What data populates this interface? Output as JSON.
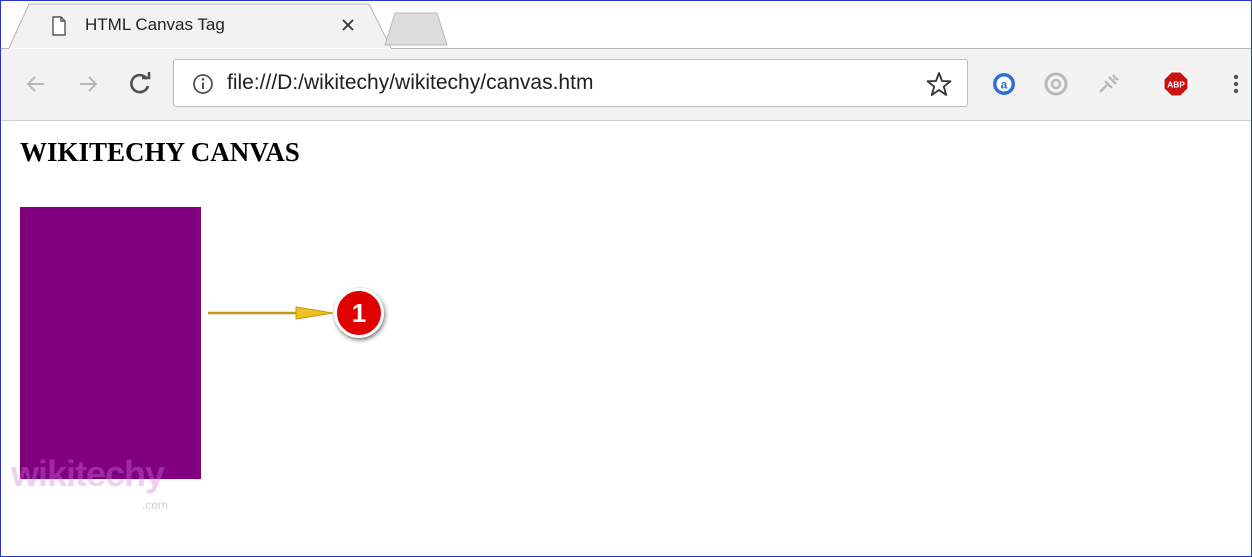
{
  "tab": {
    "title": "HTML Canvas Tag",
    "close_glyph": "✕",
    "icon": "page-icon"
  },
  "toolbar": {
    "back_glyph": "←",
    "forward_glyph": "→",
    "reload_glyph": "C",
    "url": "file:///D:/wikitechy/wikitechy/canvas.htm",
    "star_glyph": "☆",
    "menu_glyph": "⋮",
    "extensions": [
      {
        "name": "a-extension",
        "glyph": "a"
      },
      {
        "name": "ring-extension",
        "glyph": ""
      },
      {
        "name": "puzzle-extension",
        "glyph": ""
      },
      {
        "name": "adblock-extension",
        "glyph": "ABP"
      }
    ]
  },
  "page": {
    "heading": "WIKITECHY CANVAS",
    "canvas_fill": "#800080",
    "annotation": "1",
    "watermark": "wikitechy",
    "watermark_sub": ".com"
  },
  "colors": {
    "canvas_fill": "#800080",
    "arrow": "#e8b820",
    "badge": "#e00000",
    "abp": "#cc1111"
  }
}
